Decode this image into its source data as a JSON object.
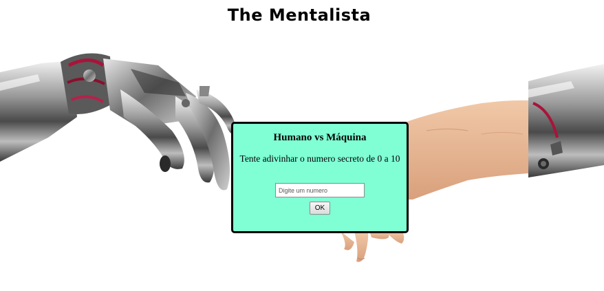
{
  "page": {
    "title": "The Mentalista"
  },
  "card": {
    "heading": "Humano vs Máquina",
    "subtitle": "Tente adivinhar o numero secreto de 0 a 10",
    "input_placeholder": "Digite um numero",
    "input_value": "",
    "ok_label": "OK",
    "background_color": "#80ffd4"
  },
  "background": {
    "image": "robot-hand-human-hand"
  }
}
